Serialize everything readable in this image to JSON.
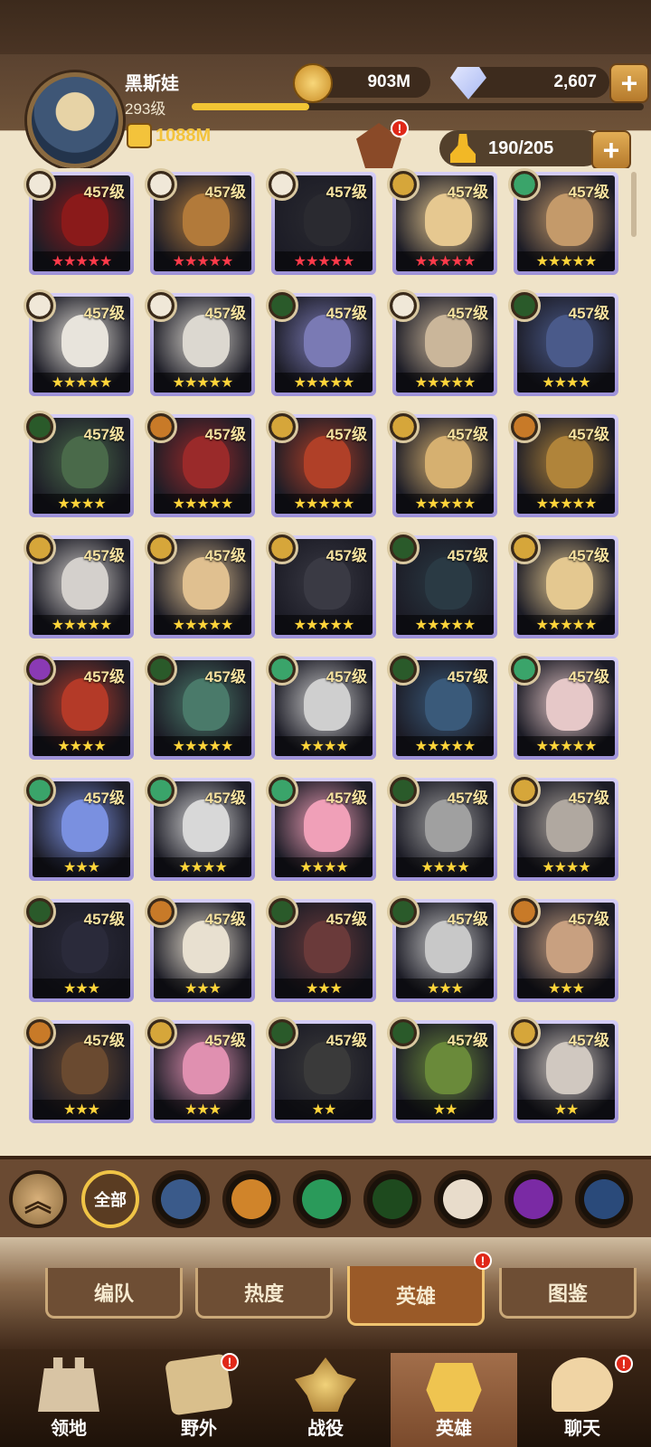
{
  "player": {
    "name": "黑斯娃",
    "level": "293级",
    "power": "1088M",
    "xp_fraction": 0.26
  },
  "resources": {
    "gold": "903M",
    "gems": "2,607"
  },
  "capacity": "190/205",
  "badge_notice": "!",
  "heroes": [
    {
      "level": "457级",
      "stars": "★★★★★",
      "star_color": "red",
      "faction": "celestial",
      "color": "#8a1a1a"
    },
    {
      "level": "457级",
      "stars": "★★★★★",
      "star_color": "red",
      "faction": "celestial",
      "color": "#b27a3a"
    },
    {
      "level": "457级",
      "stars": "★★★★★",
      "star_color": "red",
      "faction": "celestial",
      "color": "#2a2a30"
    },
    {
      "level": "457级",
      "stars": "★★★★★",
      "star_color": "red",
      "faction": "lightbearer",
      "color": "#e6c890"
    },
    {
      "level": "457级",
      "stars": "★★★★★",
      "star_color": "gold",
      "faction": "wilder",
      "color": "#c49a6a"
    },
    {
      "level": "457级",
      "stars": "★★★★★",
      "star_color": "gold",
      "faction": "celestial",
      "color": "#e8e4dc"
    },
    {
      "level": "457级",
      "stars": "★★★★★",
      "star_color": "gold",
      "faction": "celestial",
      "color": "#dcd8d0"
    },
    {
      "level": "457级",
      "stars": "★★★★★",
      "star_color": "gold",
      "faction": "graveborn",
      "color": "#7a7ab4"
    },
    {
      "level": "457级",
      "stars": "★★★★★",
      "star_color": "gold",
      "faction": "celestial",
      "color": "#cab69a"
    },
    {
      "level": "457级",
      "stars": "★★★★",
      "star_color": "gold",
      "faction": "graveborn",
      "color": "#4a5a8a"
    },
    {
      "level": "457级",
      "stars": "★★★★",
      "star_color": "gold",
      "faction": "graveborn",
      "color": "#4a6a4a"
    },
    {
      "level": "457级",
      "stars": "★★★★★",
      "star_color": "gold",
      "faction": "maulers",
      "color": "#9a2a2a"
    },
    {
      "level": "457级",
      "stars": "★★★★★",
      "star_color": "gold",
      "faction": "lightbearer",
      "color": "#b04028"
    },
    {
      "level": "457级",
      "stars": "★★★★★",
      "star_color": "gold",
      "faction": "lightbearer",
      "color": "#d6b070"
    },
    {
      "level": "457级",
      "stars": "★★★★★",
      "star_color": "gold",
      "faction": "maulers",
      "color": "#b0843a"
    },
    {
      "level": "457级",
      "stars": "★★★★★",
      "star_color": "gold",
      "faction": "lightbearer",
      "color": "#d4d0cc"
    },
    {
      "level": "457级",
      "stars": "★★★★★",
      "star_color": "gold",
      "faction": "lightbearer",
      "color": "#e0c090"
    },
    {
      "level": "457级",
      "stars": "★★★★★",
      "star_color": "gold",
      "faction": "lightbearer",
      "color": "#3a3a44"
    },
    {
      "level": "457级",
      "stars": "★★★★★",
      "star_color": "gold",
      "faction": "graveborn",
      "color": "#2a3a44"
    },
    {
      "level": "457级",
      "stars": "★★★★★",
      "star_color": "gold",
      "faction": "lightbearer",
      "color": "#e4c890"
    },
    {
      "level": "457级",
      "stars": "★★★★",
      "star_color": "gold",
      "faction": "hypogean",
      "color": "#b43a28"
    },
    {
      "level": "457级",
      "stars": "★★★★★",
      "star_color": "gold",
      "faction": "graveborn",
      "color": "#4a7a6a"
    },
    {
      "level": "457级",
      "stars": "★★★★",
      "star_color": "gold",
      "faction": "wilder",
      "color": "#cfcfcf"
    },
    {
      "level": "457级",
      "stars": "★★★★★",
      "star_color": "gold",
      "faction": "graveborn",
      "color": "#3a5a7a"
    },
    {
      "level": "457级",
      "stars": "★★★★★",
      "star_color": "gold",
      "faction": "wilder",
      "color": "#e6c8c8"
    },
    {
      "level": "457级",
      "stars": "★★★",
      "star_color": "gold",
      "faction": "wilder",
      "color": "#7a90e0"
    },
    {
      "level": "457级",
      "stars": "★★★★",
      "star_color": "gold",
      "faction": "wilder",
      "color": "#d8d8d8"
    },
    {
      "level": "457级",
      "stars": "★★★★",
      "star_color": "gold",
      "faction": "wilder",
      "color": "#f0a0b8"
    },
    {
      "level": "457级",
      "stars": "★★★★",
      "star_color": "gold",
      "faction": "graveborn",
      "color": "#a0a0a0"
    },
    {
      "level": "457级",
      "stars": "★★★★",
      "star_color": "gold",
      "faction": "lightbearer",
      "color": "#b0a8a0"
    },
    {
      "level": "457级",
      "stars": "★★★",
      "star_color": "gold",
      "faction": "graveborn",
      "color": "#2a2a3a"
    },
    {
      "level": "457级",
      "stars": "★★★",
      "star_color": "gold",
      "faction": "maulers",
      "color": "#e8e0d0"
    },
    {
      "level": "457级",
      "stars": "★★★",
      "star_color": "gold",
      "faction": "graveborn",
      "color": "#6a3a3a"
    },
    {
      "level": "457级",
      "stars": "★★★",
      "star_color": "gold",
      "faction": "graveborn",
      "color": "#c8c8c8"
    },
    {
      "level": "457级",
      "stars": "★★★",
      "star_color": "gold",
      "faction": "maulers",
      "color": "#c8a080"
    },
    {
      "level": "457级",
      "stars": "★★★",
      "star_color": "gold",
      "faction": "maulers",
      "color": "#6a4a30"
    },
    {
      "level": "457级",
      "stars": "★★★",
      "star_color": "gold",
      "faction": "lightbearer",
      "color": "#e090b0"
    },
    {
      "level": "457级",
      "stars": "★★",
      "star_color": "gold",
      "faction": "graveborn",
      "color": "#3a3a3a"
    },
    {
      "level": "457级",
      "stars": "★★",
      "star_color": "gold",
      "faction": "graveborn",
      "color": "#6a8a3a"
    },
    {
      "level": "457级",
      "stars": "★★",
      "star_color": "gold",
      "faction": "lightbearer",
      "color": "#d0c8c0"
    }
  ],
  "faction_colors": {
    "lightbearer": "#d6a63a",
    "maulers": "#c87a28",
    "wilder": "#3aa46a",
    "graveborn": "#2a5a2a",
    "celestial": "#f0e8d8",
    "hypogean": "#8a3ab4",
    "dimensional": "#4a6aa4"
  },
  "filters": {
    "all_label": "全部",
    "items": [
      {
        "name": "lightbearer-filter-icon",
        "color": "#3a5a8a"
      },
      {
        "name": "maulers-filter-icon",
        "color": "#d0842a"
      },
      {
        "name": "wilder-filter-icon",
        "color": "#2a9a5a"
      },
      {
        "name": "graveborn-filter-icon",
        "color": "#1e4a1e"
      },
      {
        "name": "celestial-filter-icon",
        "color": "#e8dccb"
      },
      {
        "name": "hypogean-filter-icon",
        "color": "#7a2aa4"
      },
      {
        "name": "dimensional-filter-icon",
        "color": "#2a4a7a"
      }
    ]
  },
  "subtabs": [
    "编队",
    "热度",
    "英雄",
    "图鉴"
  ],
  "subtab_notice": "!",
  "nav": {
    "territory": "领地",
    "wild": "野外",
    "campaign": "战役",
    "heroes": "英雄",
    "chat": "聊天",
    "notice": "!"
  }
}
